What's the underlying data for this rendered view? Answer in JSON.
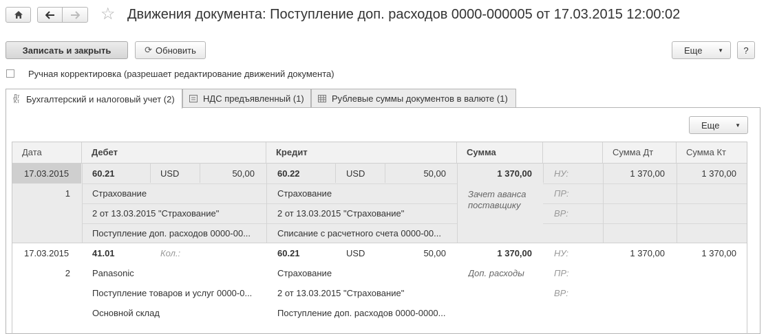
{
  "header": {
    "title": "Движения документа: Поступление доп. расходов 0000-000005 от 17.03.2015 12:00:02",
    "home_icon": "home-icon",
    "back_icon": "arrow-left-icon",
    "forward_icon": "arrow-right-icon",
    "favorite_icon": "star-icon"
  },
  "toolbar": {
    "save_close": "Записать и закрыть",
    "refresh": "Обновить",
    "more": "Еще",
    "help": "?"
  },
  "manual": {
    "label": "Ручная корректировка (разрешает редактирование движений документа)"
  },
  "tabs": [
    {
      "label": "Бухгалтерский и налоговый учет (2)",
      "icon": "dt-kt-icon"
    },
    {
      "label": "НДС предъявленный (1)",
      "icon": "register-icon"
    },
    {
      "label": "Рублевые суммы документов в валюте (1)",
      "icon": "table-icon"
    }
  ],
  "grid_toolbar": {
    "more": "Еще"
  },
  "columns": {
    "date": "Дата",
    "debit": "Дебет",
    "credit": "Кредит",
    "amount": "Сумма",
    "amount_dt": "Сумма Дт",
    "amount_kt": "Сумма Кт"
  },
  "records": [
    {
      "date": "17.03.2015",
      "num": "1",
      "dt_account": "60.21",
      "dt_cur": "USD",
      "dt_cur_sum": "50,00",
      "dt_sub": [
        "Страхование",
        "2 от 13.03.2015 \"Страхование\"",
        "Поступление доп. расходов 0000-00..."
      ],
      "kt_account": "60.22",
      "kt_cur": "USD",
      "kt_cur_sum": "50,00",
      "kt_sub": [
        "Страхование",
        "2 от 13.03.2015 \"Страхование\"",
        "Списание с расчетного счета 0000-00..."
      ],
      "amount": "1 370,00",
      "content": "Зачет аванса поставщику",
      "tax_labels": [
        "НУ:",
        "ПР:",
        "ВР:"
      ],
      "amount_dt": "1 370,00",
      "amount_kt": "1 370,00"
    },
    {
      "date": "17.03.2015",
      "num": "2",
      "dt_account": "41.01",
      "dt_qty_label": "Кол.:",
      "dt_sub": [
        "Panasonic",
        "Поступление товаров и услуг 0000-0...",
        "Основной склад"
      ],
      "kt_account": "60.21",
      "kt_cur": "USD",
      "kt_cur_sum": "50,00",
      "kt_sub": [
        "Страхование",
        "2 от 13.03.2015 \"Страхование\"",
        "Поступление доп. расходов 0000-0000..."
      ],
      "amount": "1 370,00",
      "content": "Доп. расходы",
      "tax_labels": [
        "НУ:",
        "ПР:",
        "ВР:"
      ],
      "amount_dt": "1 370,00",
      "amount_kt": "1 370,00"
    }
  ]
}
